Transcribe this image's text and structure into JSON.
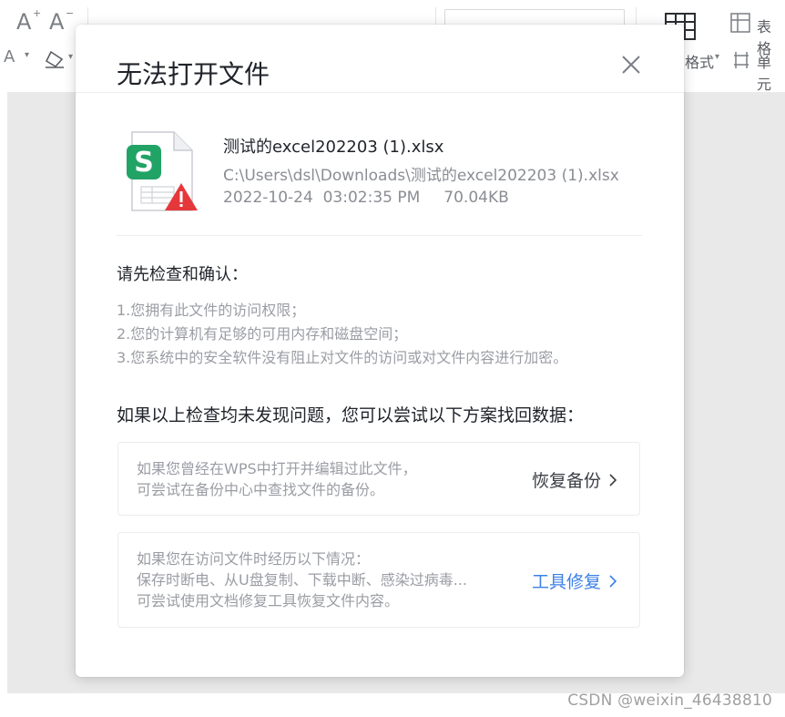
{
  "toolbar": {
    "font_increase_glyph": "A",
    "font_decrease_glyph": "A",
    "font_color_glyph": "A",
    "right_label_1": "表格",
    "right_label_2": "格式",
    "right_label_3": "单元"
  },
  "dialog": {
    "title": "无法打开文件",
    "file": {
      "name": "测试的excel202203 (1).xlsx",
      "path": "C:\\Users\\dsl\\Downloads\\测试的excel202203 (1).xlsx",
      "datetime": "2022-10-24  03:02:35 PM",
      "size": "70.04KB",
      "icon_letter": "S"
    },
    "check": {
      "title": "请先检查和确认：",
      "items": [
        "1.您拥有此文件的访问权限；",
        "2.您的计算机有足够的可用内存和磁盘空间；",
        "3.您系统中的安全软件没有阻止对文件的访问或对文件内容进行加密。"
      ]
    },
    "recover_title": "如果以上检查均未发现问题，您可以尝试以下方案找回数据：",
    "options": [
      {
        "lines": [
          "如果您曾经在WPS中打开并编辑过此文件，",
          "可尝试在备份中心中查找文件的备份。"
        ],
        "action": "恢复备份"
      },
      {
        "lines": [
          "如果您在访问文件时经历以下情况：",
          "保存时断电、从U盘复制、下载中断、感染过病毒...",
          "可尝试使用文档修复工具恢复文件内容。"
        ],
        "action": "工具修复"
      }
    ]
  },
  "watermark": "CSDN @weixin_46438810",
  "colors": {
    "accent_link": "#3d80e6",
    "excel_green": "#21a366",
    "warning_red": "#e5383b"
  }
}
